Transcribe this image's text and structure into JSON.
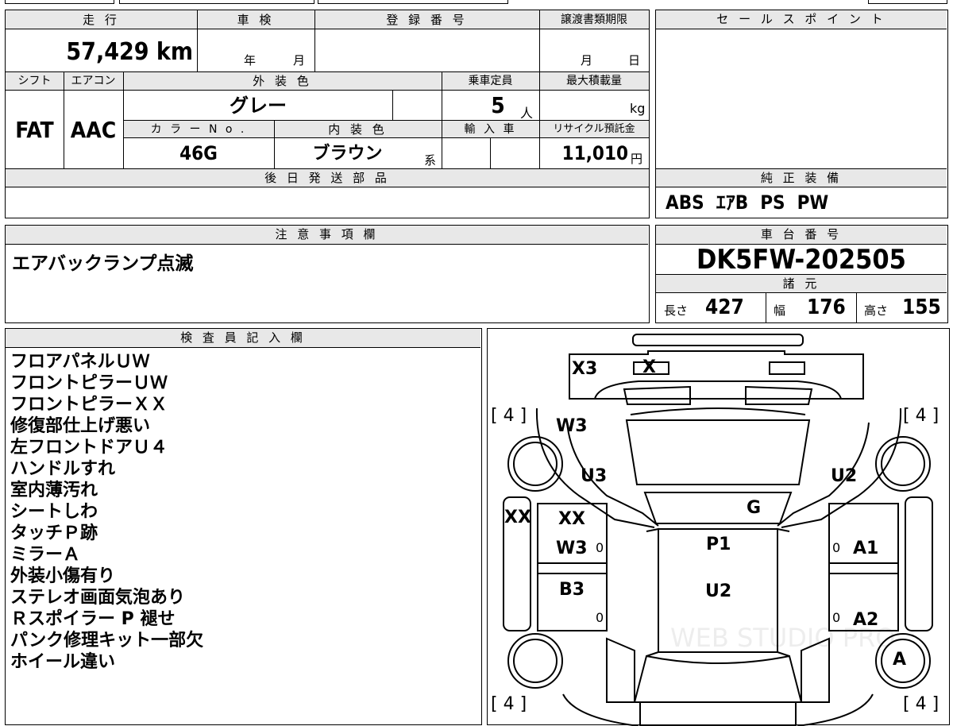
{
  "mileage": {
    "label": "走 行",
    "value": "57,429 km"
  },
  "shaken": {
    "label": "車 検",
    "year_unit": "年",
    "month_unit": "月"
  },
  "registration": {
    "label": "登 録 番 号",
    "value": ""
  },
  "transfer_deadline": {
    "label": "譲渡書類期限",
    "month_unit": "月",
    "day_unit": "日"
  },
  "sales_point": {
    "label": "セ ー ル ス ポ イ ン ト",
    "value": ""
  },
  "shift": {
    "label": "シフト",
    "value": "FAT"
  },
  "aircon": {
    "label": "エアコン",
    "value": "AAC"
  },
  "exterior_color": {
    "label": "外 装 色",
    "value": "グレー"
  },
  "capacity": {
    "label": "乗車定員",
    "value": "5",
    "unit": "人"
  },
  "max_load": {
    "label": "最大積載量",
    "unit": "kg"
  },
  "color_no": {
    "label": "カ ラ ー N o .",
    "value": "46G"
  },
  "interior_color": {
    "label": "内 装 色",
    "value": "ブラウン",
    "suffix": "系"
  },
  "import_car": {
    "label": "輸 入 車"
  },
  "recycle_fee": {
    "label": "リサイクル預託金",
    "value": "11,010",
    "unit": "円"
  },
  "later_parts": {
    "label": "後 日 発 送 部 品",
    "value": ""
  },
  "genuine_equipment": {
    "label": "純 正 装 備",
    "value": "ABS  ｴｱB  PS  PW"
  },
  "caution": {
    "label": "注 意 事 項 欄",
    "value": "エアバックランプ点滅"
  },
  "chassis_number": {
    "label": "車 台 番 号",
    "value": "DK5FW-202505"
  },
  "specs": {
    "label": "諸 元",
    "length_label": "長さ",
    "length": "427",
    "width_label": "幅",
    "width": "176",
    "height_label": "高さ",
    "height": "155"
  },
  "inspector": {
    "label": "検 査 員 記 入 欄",
    "notes": [
      "フロアパネルＵＷ",
      "フロントピラーＵＷ",
      "フロントピラーＸＸ",
      "修復部仕上げ悪い",
      "左フロントドアＵ４",
      "ハンドルすれ",
      "室内薄汚れ",
      "シートしわ",
      "タッチＰ跡",
      "ミラーＡ",
      "外装小傷有り",
      "ステレオ画面気泡あり",
      "Ｒスポイラー P 褪せ",
      "パンク修理キット一部欠",
      "ホイール違い"
    ]
  },
  "diagram": {
    "tire_fl": "[ 4 ]",
    "tire_fr": "[ 4 ]",
    "tire_rl": "[ 4 ]",
    "tire_rr": "[ 4 ]",
    "rear_bumper": "X3",
    "rear_marker": "X",
    "fl_fender": "W3",
    "fl_panel": "U3",
    "left_sill": "XX",
    "left_front_door_1": "XX",
    "left_front_door_2": "W3",
    "left_rear_door": "B3",
    "zero_1": "0",
    "zero_2": "0",
    "zero_3": "0",
    "zero_4": "0",
    "windshield": "G",
    "roof_1": "P1",
    "roof_2": "U2",
    "rr_panel": "U2",
    "right_front_door": "A1",
    "right_rear_door": "A2",
    "right_rear_wheel": "A"
  },
  "watermark": "WEB STUDIO PRO"
}
